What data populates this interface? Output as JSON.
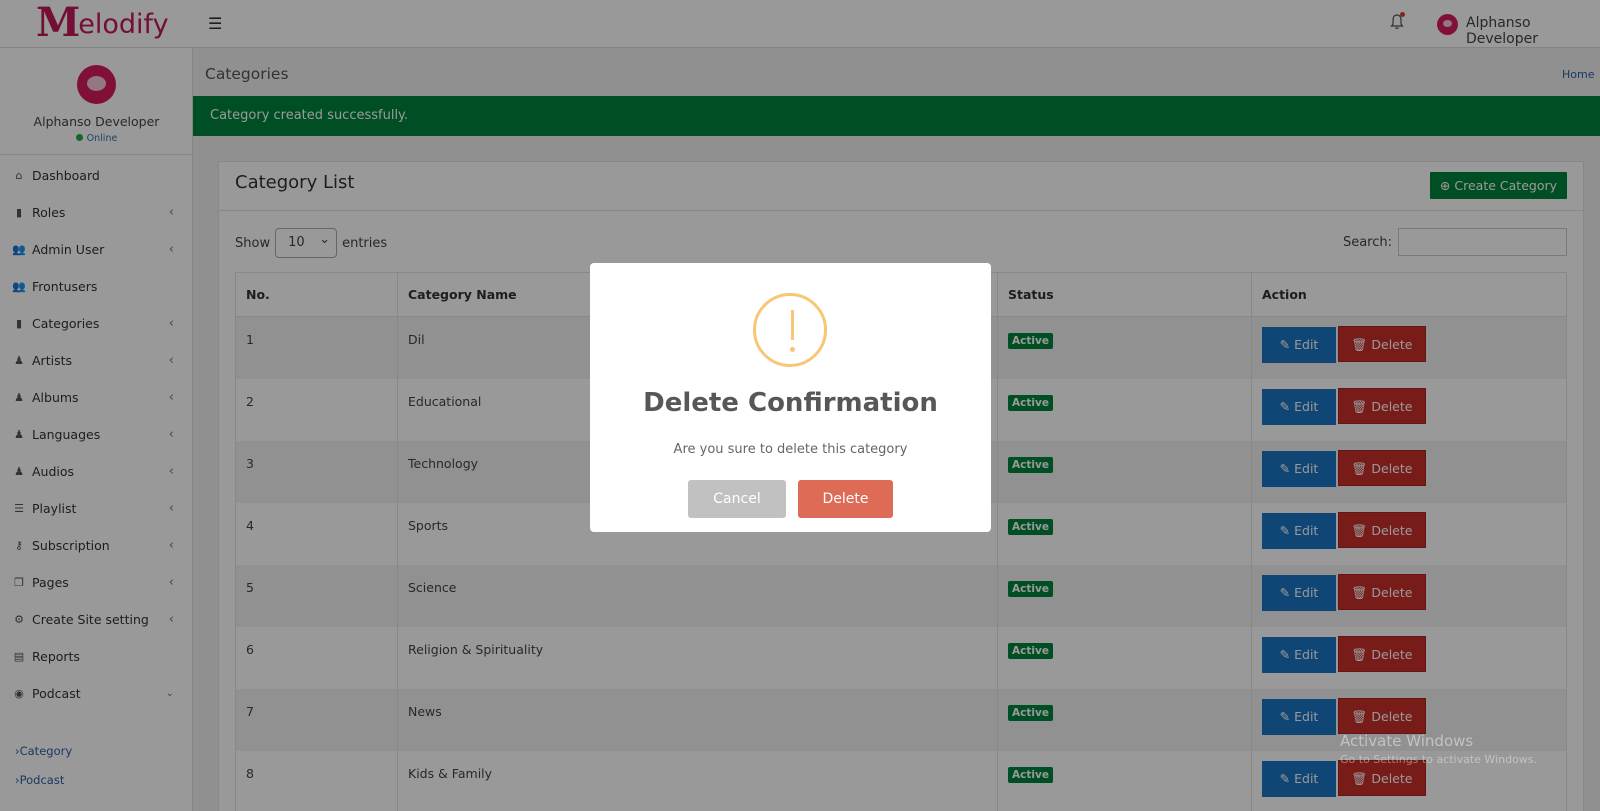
{
  "app": {
    "logo_m": "M",
    "logo_text": "elodify",
    "user_name": "Alphanso Developer"
  },
  "sidebar": {
    "user_name": "Alphanso Developer",
    "status": "Online",
    "items": [
      {
        "label": "Dashboard",
        "icon": "home-icon",
        "glyph": "⌂",
        "has_chevron": false
      },
      {
        "label": "Roles",
        "icon": "briefcase-icon",
        "glyph": "▮",
        "has_chevron": true
      },
      {
        "label": "Admin User",
        "icon": "users-icon",
        "glyph": "👥",
        "has_chevron": true
      },
      {
        "label": "Frontusers",
        "icon": "users-icon",
        "glyph": "👥",
        "has_chevron": false
      },
      {
        "label": "Categories",
        "icon": "briefcase-icon",
        "glyph": "▮",
        "has_chevron": true
      },
      {
        "label": "Artists",
        "icon": "person-icon",
        "glyph": "♟",
        "has_chevron": true
      },
      {
        "label": "Albums",
        "icon": "person-icon",
        "glyph": "♟",
        "has_chevron": true
      },
      {
        "label": "Languages",
        "icon": "person-icon",
        "glyph": "♟",
        "has_chevron": true
      },
      {
        "label": "Audios",
        "icon": "person-icon",
        "glyph": "♟",
        "has_chevron": true
      },
      {
        "label": "Playlist",
        "icon": "list-icon",
        "glyph": "☰",
        "has_chevron": true
      },
      {
        "label": "Subscription",
        "icon": "key-icon",
        "glyph": "⚷",
        "has_chevron": true
      },
      {
        "label": "Pages",
        "icon": "copy-icon",
        "glyph": "❐",
        "has_chevron": true
      },
      {
        "label": "Create Site setting",
        "icon": "gears-icon",
        "glyph": "⚙",
        "has_chevron": true
      },
      {
        "label": "Reports",
        "icon": "file-icon",
        "glyph": "▤",
        "has_chevron": false
      },
      {
        "label": "Podcast",
        "icon": "podcast-icon",
        "glyph": "◉",
        "has_chevron": true
      }
    ],
    "submenu": [
      {
        "label": "Category"
      },
      {
        "label": "Podcast"
      }
    ]
  },
  "content": {
    "title": "Categories",
    "breadcrumb_home": "Home",
    "alert": "Category created successfully."
  },
  "card": {
    "title": "Category List",
    "create_button": "Create Category",
    "show_label": "Show",
    "entries_value": "10",
    "entries_label": "entries",
    "search_label": "Search:",
    "columns": [
      "No.",
      "Category Name",
      "Status",
      "Action"
    ],
    "rows": [
      {
        "no": "1",
        "name": "Dil",
        "status": "Active"
      },
      {
        "no": "2",
        "name": "Educational",
        "status": "Active"
      },
      {
        "no": "3",
        "name": "Technology",
        "status": "Active"
      },
      {
        "no": "4",
        "name": "Sports",
        "status": "Active"
      },
      {
        "no": "5",
        "name": "Science",
        "status": "Active"
      },
      {
        "no": "6",
        "name": "Religion & Spirituality",
        "status": "Active"
      },
      {
        "no": "7",
        "name": "News",
        "status": "Active"
      },
      {
        "no": "8",
        "name": "Kids & Family",
        "status": "Active"
      }
    ],
    "edit_label": "Edit",
    "delete_label": "Delete"
  },
  "modal": {
    "title": "Delete Confirmation",
    "text": "Are you sure to delete this category",
    "cancel": "Cancel",
    "confirm": "Delete"
  },
  "watermark": {
    "title": "Activate Windows",
    "subtitle": "Go to Settings to activate Windows."
  },
  "colors": {
    "brand": "#c2185b",
    "success": "#00843d",
    "edit": "#1a76c3",
    "delete": "#c9302c",
    "warning": "#f8c675",
    "confirm": "#dd6b55"
  }
}
